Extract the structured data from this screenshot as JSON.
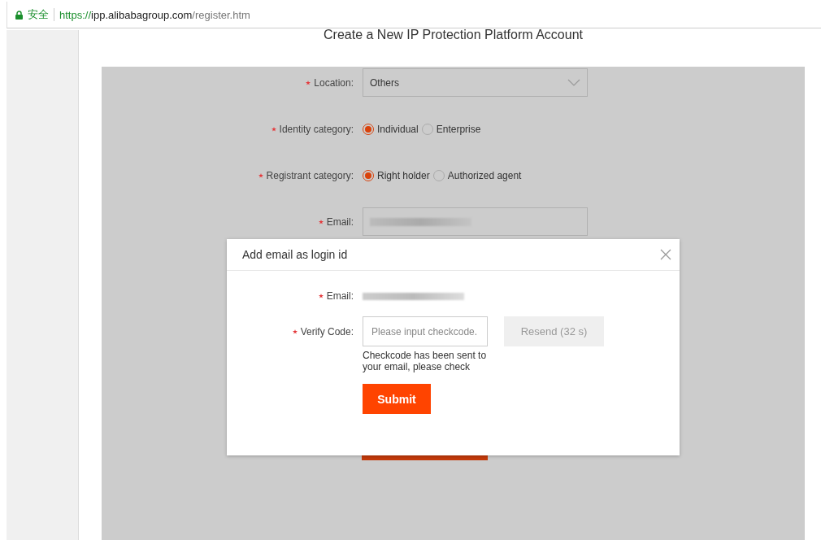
{
  "address_bar": {
    "security_label": "安全",
    "url": {
      "scheme": "https://",
      "host": "ipp.alibabagroup.com",
      "path": "/register.htm"
    }
  },
  "page_title": "Create a New IP Protection Platform Account",
  "form": {
    "fields": [
      {
        "kind": "select",
        "label": "Location:",
        "required": true,
        "value": "Others"
      },
      {
        "kind": "radio",
        "label": "Identity category:",
        "required": true,
        "options": [
          {
            "label": "Individual",
            "selected": true
          },
          {
            "label": "Enterprise",
            "selected": false
          }
        ]
      },
      {
        "kind": "radio",
        "label": "Registrant category:",
        "required": true,
        "options": [
          {
            "label": "Right holder",
            "selected": true
          },
          {
            "label": "Authorized agent",
            "selected": false
          }
        ]
      },
      {
        "kind": "redacted",
        "label": "Email:",
        "required": true
      }
    ]
  },
  "dialog": {
    "title": "Add email as login id",
    "fields": [
      {
        "kind": "redacted",
        "label": "Email:",
        "required": true
      },
      {
        "kind": "input",
        "label": "Verify Code:",
        "required": true,
        "placeholder": "Please input checkcode.",
        "hint": "Checkcode has been sent to your email, please check",
        "button": {
          "label": "Resend (32 s)",
          "disabled": true
        }
      }
    ],
    "submit": "Submit"
  }
}
